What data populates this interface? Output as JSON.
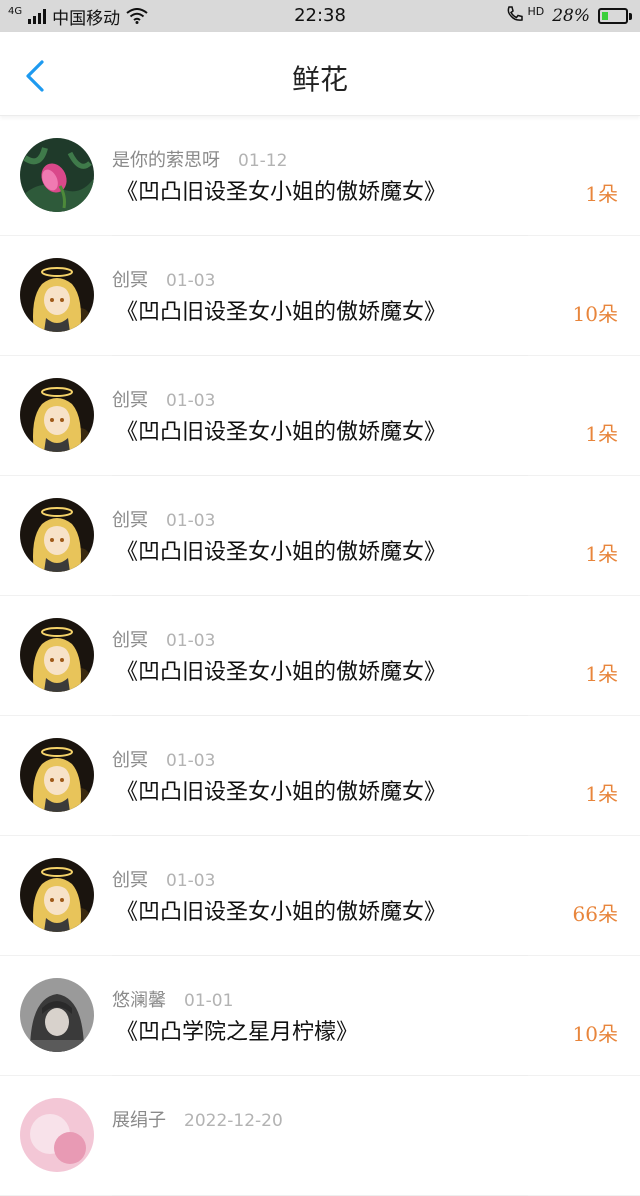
{
  "status_bar": {
    "carrier": "中国移动",
    "network": "4G",
    "time": "22:38",
    "hd_label": "HD",
    "battery_level": 28,
    "battery_text": "28%",
    "battery_color": "#3ccf3c"
  },
  "header": {
    "title": "鲜花",
    "back_icon": "chevron-left-icon",
    "accent": "#1e9af0"
  },
  "accent_count_color": "#e8853b",
  "items": [
    {
      "user": "是你的萦思呀",
      "date": "01-12",
      "book": "《凹凸旧设圣女小姐的傲娇魔女》",
      "count": "1朵",
      "avatar": "flower"
    },
    {
      "user": "创冥",
      "date": "01-03",
      "book": "《凹凸旧设圣女小姐的傲娇魔女》",
      "count": "10朵",
      "avatar": "angel"
    },
    {
      "user": "创冥",
      "date": "01-03",
      "book": "《凹凸旧设圣女小姐的傲娇魔女》",
      "count": "1朵",
      "avatar": "angel"
    },
    {
      "user": "创冥",
      "date": "01-03",
      "book": "《凹凸旧设圣女小姐的傲娇魔女》",
      "count": "1朵",
      "avatar": "angel"
    },
    {
      "user": "创冥",
      "date": "01-03",
      "book": "《凹凸旧设圣女小姐的傲娇魔女》",
      "count": "1朵",
      "avatar": "angel"
    },
    {
      "user": "创冥",
      "date": "01-03",
      "book": "《凹凸旧设圣女小姐的傲娇魔女》",
      "count": "1朵",
      "avatar": "angel"
    },
    {
      "user": "创冥",
      "date": "01-03",
      "book": "《凹凸旧设圣女小姐的傲娇魔女》",
      "count": "66朵",
      "avatar": "angel"
    },
    {
      "user": "悠澜馨",
      "date": "01-01",
      "book": "《凹凸学院之星月柠檬》",
      "count": "10朵",
      "avatar": "hooded"
    },
    {
      "user": "展绢子",
      "date": "2022-12-20",
      "book": "",
      "count": "",
      "avatar": "pink"
    }
  ]
}
